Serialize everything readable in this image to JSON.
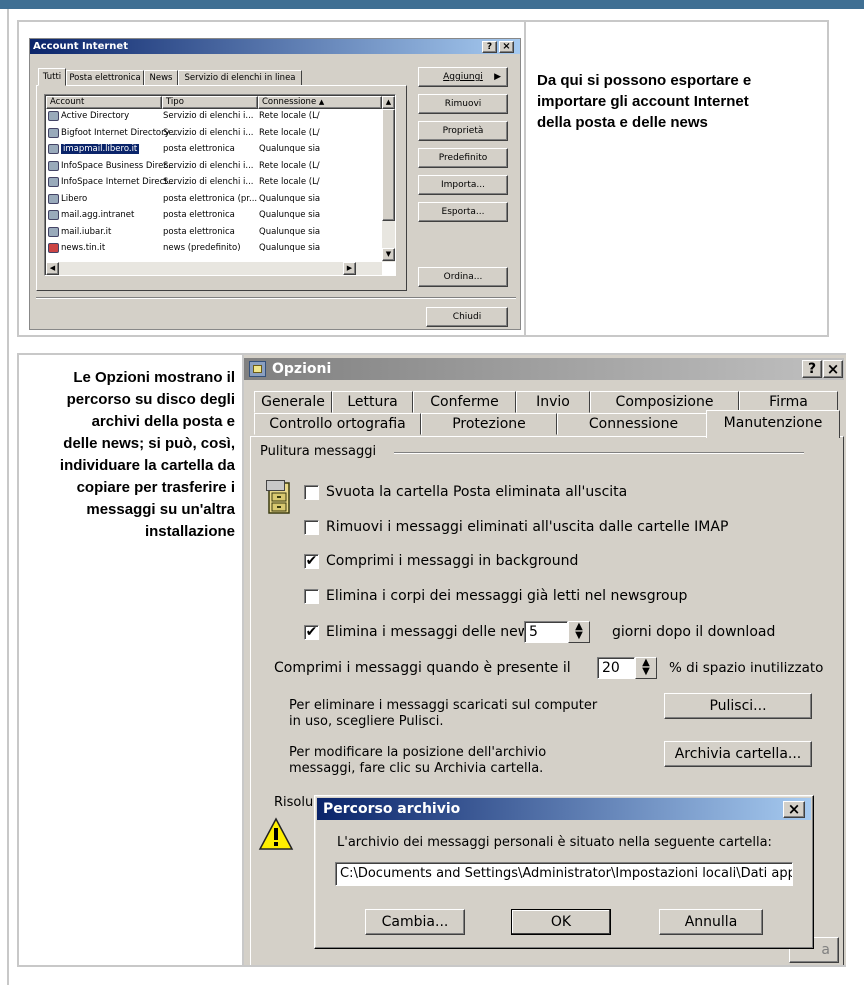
{
  "panel1": {
    "dialog_title": "Account Internet",
    "title_buttons": [
      "?",
      "×"
    ],
    "tabs": [
      "Tutti",
      "Posta elettronica",
      "News",
      "Servizio di elenchi in linea"
    ],
    "columns": [
      "Account",
      "Tipo",
      "Connessione"
    ],
    "rows": [
      {
        "account": "Active Directory",
        "tipo": "Servizio di elenchi i...",
        "conn": "Rete locale (L/"
      },
      {
        "account": "Bigfoot Internet Directory ...",
        "tipo": "Servizio di elenchi i...",
        "conn": "Rete locale (L/"
      },
      {
        "account": "imapmail.libero.it",
        "tipo": "posta elettronica",
        "conn": "Qualunque sia"
      },
      {
        "account": "InfoSpace Business Direc...",
        "tipo": "Servizio di elenchi i...",
        "conn": "Rete locale (L/"
      },
      {
        "account": "InfoSpace Internet Direct...",
        "tipo": "Servizio di elenchi i...",
        "conn": "Rete locale (L/"
      },
      {
        "account": "Libero",
        "tipo": "posta elettronica (pr...",
        "conn": "Qualunque sia"
      },
      {
        "account": "mail.agg.intranet",
        "tipo": "posta elettronica",
        "conn": "Qualunque sia"
      },
      {
        "account": "mail.iubar.it",
        "tipo": "posta elettronica",
        "conn": "Qualunque sia"
      },
      {
        "account": "news.tin.it",
        "tipo": "news (predefinito)",
        "conn": "Qualunque sia"
      }
    ],
    "selected_row": 2,
    "buttons": [
      "Aggiungi",
      "Rimuovi",
      "Proprietà",
      "Predefinito",
      "Importa...",
      "Esporta...",
      "Ordina...",
      "Chiudi"
    ],
    "caption": "Da qui si possono esportare e importare gli account Internet della posta e delle news"
  },
  "panel2": {
    "caption": "Le Opzioni mostrano il percorso su disco degli archivi della posta e delle news; si può, così, individuare la cartella da copiare per trasferire i messaggi su un'altra installazione",
    "dialog_title": "Opzioni",
    "title_buttons": [
      "?",
      "×"
    ],
    "tabs_row1": [
      "Generale",
      "Lettura",
      "Conferme",
      "Invio",
      "Composizione",
      "Firma"
    ],
    "tabs_row2": [
      "Controllo ortografia",
      "Protezione",
      "Connessione",
      "Manutenzione"
    ],
    "active_tab": "Manutenzione",
    "group_title": "Pulitura messaggi",
    "options": [
      {
        "label": "Svuota la cartella Posta eliminata all'uscita",
        "checked": false
      },
      {
        "label": "Rimuovi i messaggi eliminati all'uscita dalle cartelle IMAP",
        "checked": false
      },
      {
        "label": "Comprimi i messaggi in background",
        "checked": true
      },
      {
        "label": "Elimina i corpi dei messaggi già letti nel newsgroup",
        "checked": false
      },
      {
        "label": "Elimina i messaggi delle news",
        "checked": true
      }
    ],
    "news_days_value": "5",
    "news_days_suffix": "giorni dopo il download",
    "compact_prefix": "Comprimi i messaggi quando è presente il",
    "compact_value": "20",
    "compact_suffix": "% di spazio inutilizzato",
    "clean_text_1": "Per eliminare i messaggi scaricati sul computer",
    "clean_text_2": "in uso, scegliere Pulisci.",
    "clean_button": "Pulisci...",
    "archive_text_1": "Per modificare la posizione dell'archivio",
    "archive_text_2": "messaggi, fare clic su Archivia cartella.",
    "archive_button": "Archivia cartella...",
    "troubleshoot_partial": "Risolu",
    "hidden_button_partial": "a",
    "percorso": {
      "title": "Percorso archivio",
      "close": "×",
      "message": "L'archivio dei messaggi personali è situato nella seguente cartella:",
      "path": "C:\\Documents and Settings\\Administrator\\Impostazioni locali\\Dati app",
      "buttons": [
        "Cambia...",
        "OK",
        "Annulla"
      ]
    }
  },
  "colors": {
    "topbar": "#3f6f93",
    "title_blue": "#0a246a",
    "dialog_gray": "#d4d0c8",
    "selection": "#0a246a"
  }
}
